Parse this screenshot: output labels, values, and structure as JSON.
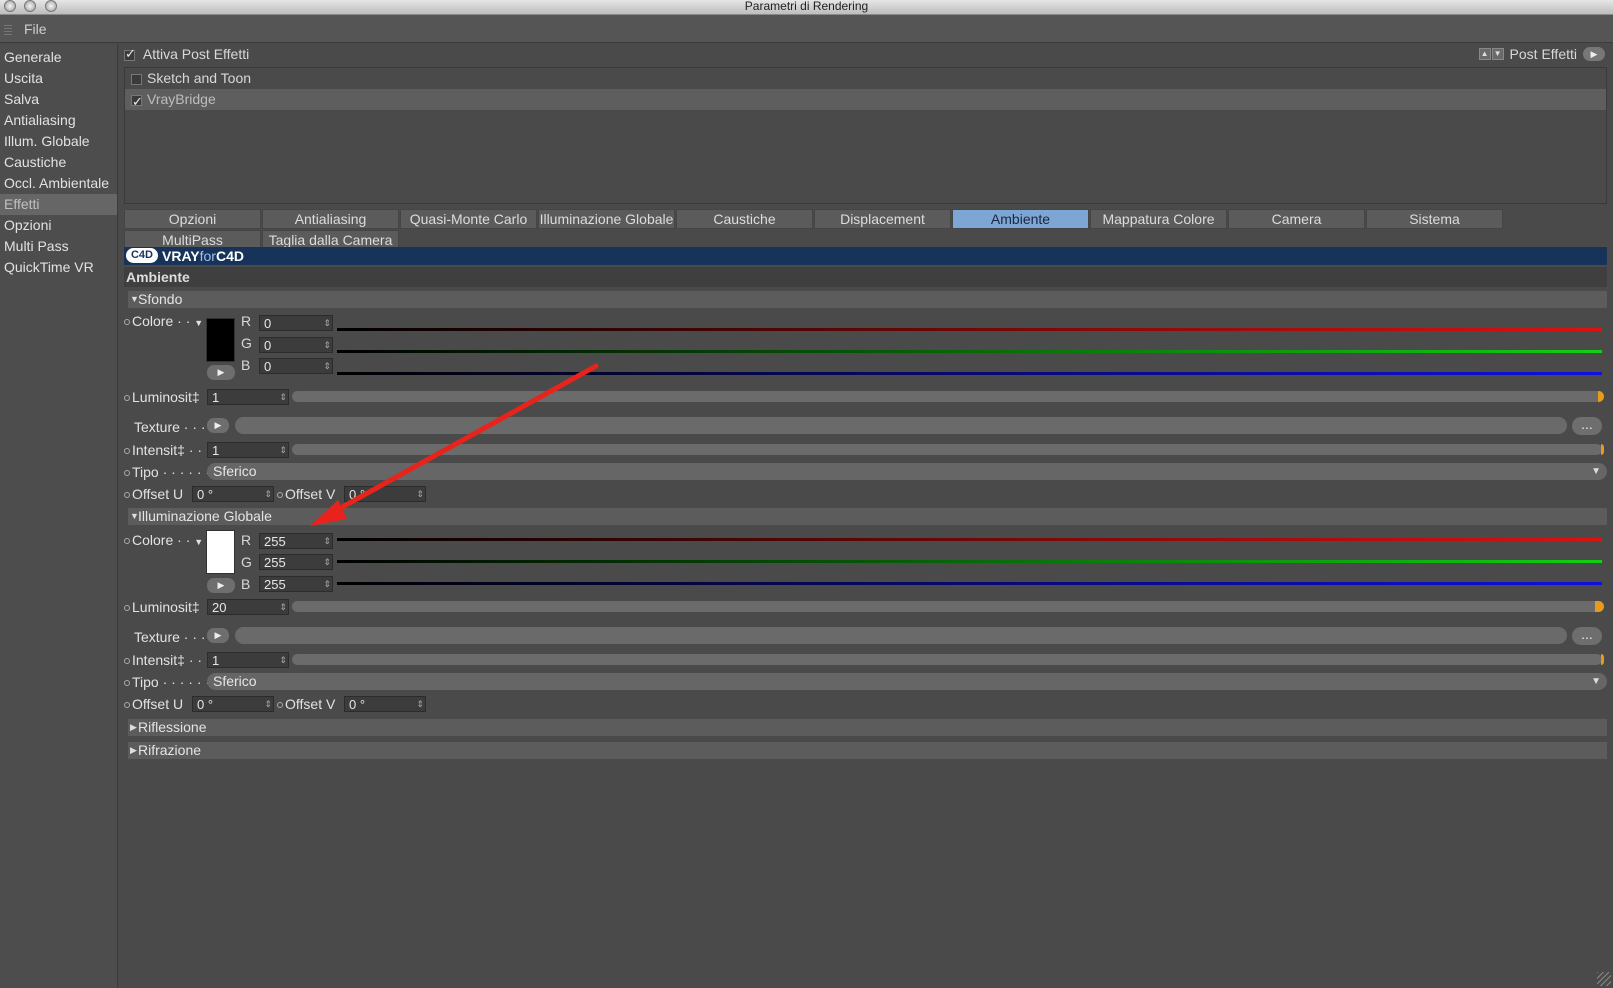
{
  "window": {
    "title": "Parametri di Rendering"
  },
  "menu": {
    "file": "File"
  },
  "sidebar": {
    "items": [
      {
        "label": "Generale"
      },
      {
        "label": "Uscita"
      },
      {
        "label": "Salva"
      },
      {
        "label": "Antialiasing"
      },
      {
        "label": "Illum. Globale"
      },
      {
        "label": "Caustiche"
      },
      {
        "label": "Occl. Ambientale"
      },
      {
        "label": "Effetti"
      },
      {
        "label": "Opzioni"
      },
      {
        "label": "Multi Pass"
      },
      {
        "label": "QuickTime VR"
      }
    ]
  },
  "post_effects": {
    "enable_label": "Attiva Post Effetti",
    "menu_label": "Post Effetti",
    "items": [
      {
        "label": "Sketch and Toon",
        "checked": false
      },
      {
        "label": "VrayBridge",
        "checked": true
      }
    ]
  },
  "tabs": {
    "row1": [
      "Opzioni",
      "Antialiasing",
      "Quasi-Monte Carlo",
      "Illuminazione Globale",
      "Caustiche",
      "Displacement",
      "Ambiente",
      "Mappatura Colore",
      "Camera",
      "Sistema"
    ],
    "row2": [
      "MultiPass",
      "Taglia dalla Camera"
    ],
    "active": "Ambiente"
  },
  "vray": {
    "brand_a": "VRAY",
    "brand_b": "for",
    "brand_c": "C4D",
    "logo": "C4D"
  },
  "section_title": "Ambiente",
  "sfondo": {
    "title": "Sfondo",
    "colore_label": "Colore",
    "r_label": "R",
    "g_label": "G",
    "b_label": "B",
    "r": "0",
    "g": "0",
    "b": "0",
    "swatch_color": "#000000",
    "lum_label": "Luminosit‡",
    "luminosita": "1",
    "texture_label": "Texture",
    "intens_label": "Intensit‡",
    "intensita": "1",
    "tipo_label": "Tipo",
    "tipo": "Sferico",
    "offset_u_label": "Offset U",
    "offset_u": "0 °",
    "offset_v_label": "Offset V",
    "offset_v": "0 °"
  },
  "illum": {
    "title": "Illuminazione Globale",
    "colore_label": "Colore",
    "r_label": "R",
    "g_label": "G",
    "b_label": "B",
    "r": "255",
    "g": "255",
    "b": "255",
    "swatch_color": "#ffffff",
    "lum_label": "Luminosit‡",
    "luminosita": "20",
    "texture_label": "Texture",
    "intens_label": "Intensit‡",
    "intensita": "1",
    "tipo_label": "Tipo",
    "tipo": "Sferico",
    "offset_u_label": "Offset U",
    "offset_u": "0 °",
    "offset_v_label": "Offset V",
    "offset_v": "0 °"
  },
  "collapsed": {
    "riflessione": "Riflessione",
    "rifrazione": "Rifrazione"
  },
  "ellipsis": "...",
  "colors": {
    "accent_tab": "#7ea6d4",
    "annotation_arrow": "#e8231c",
    "vray_bar": "#17335a"
  }
}
